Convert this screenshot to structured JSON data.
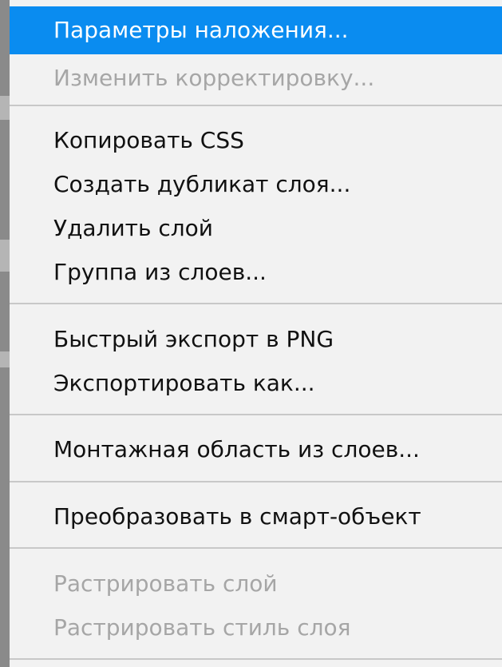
{
  "context_menu": {
    "items": [
      {
        "label": "Параметры наложения...",
        "state": "highlighted"
      },
      {
        "label": "Изменить корректировку...",
        "state": "disabled"
      },
      {
        "label": "Копировать CSS",
        "state": "enabled"
      },
      {
        "label": "Создать дубликат слоя...",
        "state": "enabled"
      },
      {
        "label": "Удалить слой",
        "state": "enabled"
      },
      {
        "label": "Группа из слоев...",
        "state": "enabled"
      },
      {
        "label": "Быстрый экспорт в PNG",
        "state": "enabled"
      },
      {
        "label": "Экспортировать как...",
        "state": "enabled"
      },
      {
        "label": "Монтажная область из слоев...",
        "state": "enabled"
      },
      {
        "label": "Преобразовать в смарт-объект",
        "state": "enabled"
      },
      {
        "label": "Растрировать слой",
        "state": "disabled"
      },
      {
        "label": "Растрировать стиль слоя",
        "state": "disabled"
      }
    ]
  },
  "colors": {
    "highlight": "#0a8cf0",
    "disabled_text": "#a6a6a6",
    "menu_background": "#f2f2f2"
  }
}
